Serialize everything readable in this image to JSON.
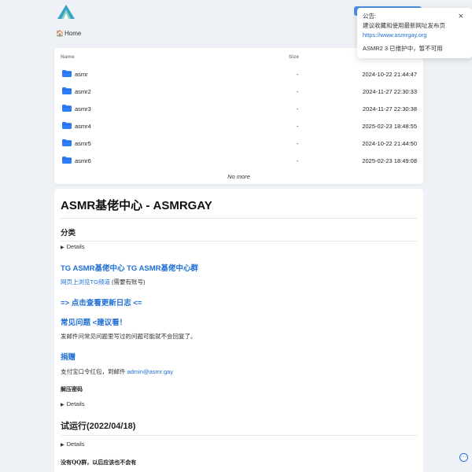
{
  "header": {
    "logo_icon": "logo-icon"
  },
  "notice": {
    "title": "公告:",
    "line1": "建议收藏和使用最新网址发布页",
    "link": "https://www.asmrgay.org",
    "line2": "ASMR2 3 已维护中，暂不可用",
    "close": "×"
  },
  "breadcrumb": {
    "home": "Home",
    "home_icon": "🏠"
  },
  "file_table": {
    "col_name": "Name",
    "col_size": "Size",
    "rows": [
      {
        "name": "asmr",
        "size": "-",
        "modified": "2024-10-22 21:44:47"
      },
      {
        "name": "asmr2",
        "size": "-",
        "modified": "2024-11-27 22:30:33"
      },
      {
        "name": "asmr3",
        "size": "-",
        "modified": "2024-11-27 22:30:38"
      },
      {
        "name": "asmr4",
        "size": "-",
        "modified": "2025-02-23 18:48:55"
      },
      {
        "name": "asmr5",
        "size": "-",
        "modified": "2024-10-22 21:44:50"
      },
      {
        "name": "asmr6",
        "size": "-",
        "modified": "2025-02-23 18:49:08"
      }
    ],
    "footer": "No more"
  },
  "readme": {
    "title": "ASMR基佬中心 - ASMRGAY",
    "section_category": "分类",
    "details": "Details",
    "tg_heading": "TG ASMR基佬中心 TG ASMR基佬中心群",
    "tg_link": "网页上浏览TG频道",
    "tg_note": "(需要有账号)",
    "changelog_link": "=> 点击查看更新日志 <=",
    "faq_link": "常见问题 <建议看！",
    "faq_note": "发邮件问常见问题里写过的问题可能就不会回复了。",
    "donate_link": "捐赠",
    "donate_text": "支付宝口令红包，到邮件",
    "donate_email": "admin@asmr.gay",
    "unzip_label": "解压密码",
    "trial_heading": "试运行(2022/04/18)",
    "qq_note": "没有QQ群，以后应该也不会有"
  },
  "colors": {
    "accent": "#1f6fd6",
    "folder": "#2d7ff9",
    "background": "#eef1f5"
  }
}
